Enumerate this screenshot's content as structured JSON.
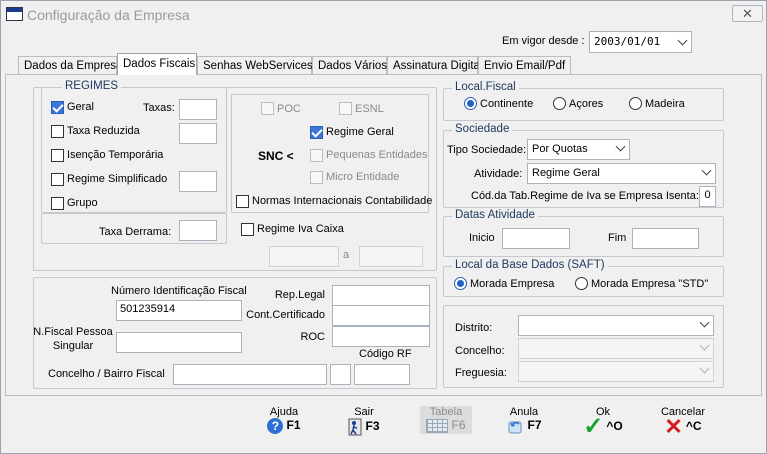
{
  "window": {
    "title": "Configuração da Empresa",
    "icon_text": "SOFTWARE",
    "close_label": "✕"
  },
  "header": {
    "em_vigor_label": "Em vigor desde :",
    "em_vigor_value": "2003/01/01"
  },
  "tabs": [
    {
      "label": "Dados da Empresa"
    },
    {
      "label": "Dados Fiscais"
    },
    {
      "label": "Senhas WebServices"
    },
    {
      "label": "Dados Vários"
    },
    {
      "label": "Assinatura Digital"
    },
    {
      "label": "Envio Email/Pdf"
    }
  ],
  "regimes": {
    "title": "REGIMES",
    "taxas_label": "Taxas:",
    "items": [
      {
        "label": "Geral",
        "checked": true
      },
      {
        "label": "Taxa Reduzida",
        "checked": false
      },
      {
        "label": "Isenção Temporária",
        "checked": false
      },
      {
        "label": "Regime Simplificado",
        "checked": false
      },
      {
        "label": "Grupo",
        "checked": false
      }
    ],
    "taxa_derrama_label": "Taxa Derrama:"
  },
  "snc": {
    "poc_label": "POC",
    "esnl_label": "ESNL",
    "snc_label": "SNC <",
    "regime_geral_label": "Regime Geral",
    "pequenas_label": "Pequenas Entidades",
    "micro_label": "Micro Entidade",
    "normas_label": "Normas Internacionais Contabilidade",
    "iva_caixa_label": "Regime Iva Caixa",
    "a_label": "a"
  },
  "fiscal_id": {
    "nif_label": "Número Identificação Fiscal",
    "nif_value": "501235914",
    "nf_pessoa_label_1": "N.Fiscal Pessoa",
    "nf_pessoa_label_2": "Singular",
    "rep_legal_label": "Rep.Legal",
    "cont_cert_label": "Cont.Certificado",
    "roc_label": "ROC",
    "codigo_rf_label": "Código RF",
    "concelho_label": "Concelho / Bairro Fiscal"
  },
  "local_fiscal": {
    "title": "Local.Fiscal",
    "options": [
      {
        "label": "Continente",
        "selected": true
      },
      {
        "label": "Açores",
        "selected": false
      },
      {
        "label": "Madeira",
        "selected": false
      }
    ]
  },
  "sociedade": {
    "title": "Sociedade",
    "tipo_label": "Tipo Sociedade:",
    "tipo_value": "Por Quotas",
    "atividade_label": "Atividade:",
    "atividade_value": "Regime Geral",
    "cod_tab_label": "Cód.da Tab.Regime de Iva se Empresa Isenta:",
    "cod_tab_value": "0"
  },
  "datas": {
    "title": "Datas Atividade",
    "inicio_label": "Inicio",
    "fim_label": "Fim"
  },
  "saft": {
    "title": "Local da Base Dados (SAFT)",
    "options": [
      {
        "label": "Morada Empresa",
        "selected": true
      },
      {
        "label": "Morada Empresa \"STD\"",
        "selected": false
      }
    ]
  },
  "location": {
    "distrito_label": "Distrito:",
    "concelho_label": "Concelho:",
    "freguesia_label": "Freguesia:"
  },
  "buttons": [
    {
      "label": "Ajuda",
      "key": "F1",
      "icon": "help-icon"
    },
    {
      "label": "Sair",
      "key": "F3",
      "icon": "exit-door-icon"
    },
    {
      "label": "Tabela",
      "key": "F6",
      "icon": "table-icon"
    },
    {
      "label": "Anula",
      "key": "F7",
      "icon": "undo-icon"
    },
    {
      "label": "Ok",
      "key": "^O",
      "icon": "checkmark-icon"
    },
    {
      "label": "Cancelar",
      "key": "^C",
      "icon": "x-icon"
    }
  ],
  "colors": {
    "accent": "#1f5fc8",
    "group_title": "#1f3a60",
    "ok_green": "#1aa22a",
    "cancel_red": "#d61c1c"
  }
}
